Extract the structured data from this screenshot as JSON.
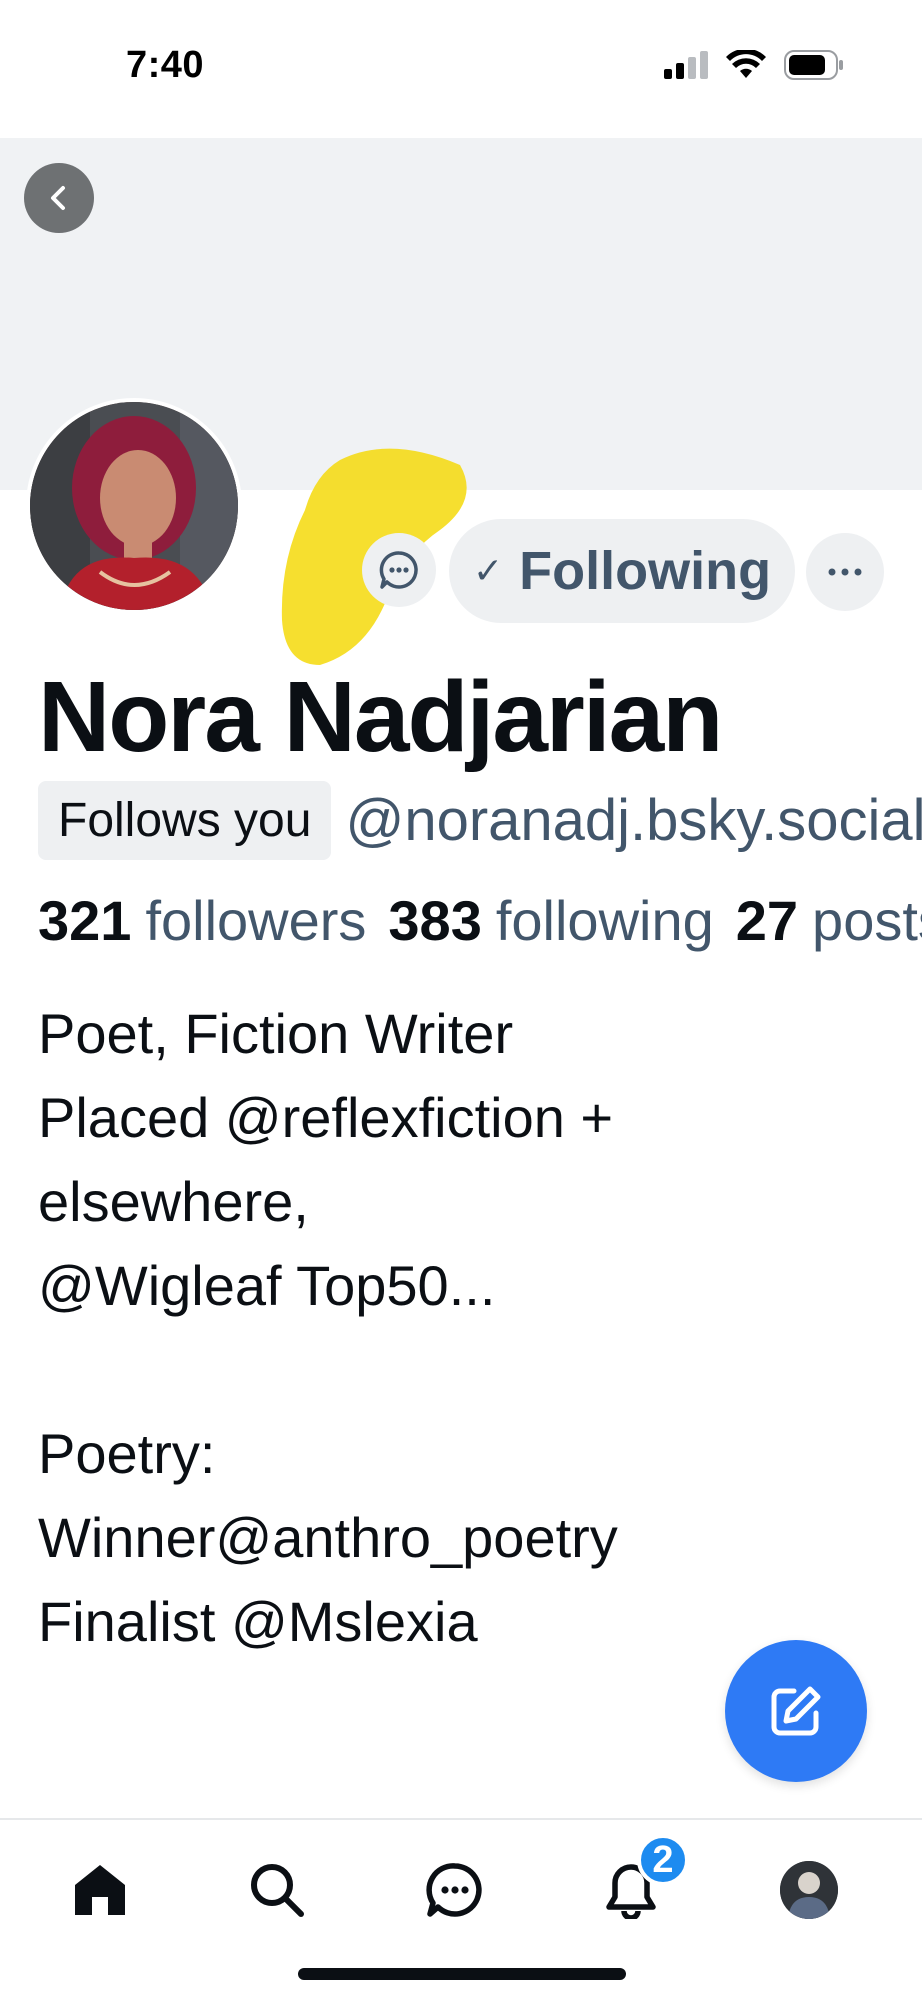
{
  "status_bar": {
    "time": "7:40"
  },
  "profile": {
    "display_name": "Nora Nadjarian",
    "follows_you_label": "Follows you",
    "handle": "@noranadj.bsky.social",
    "following_button_label": "Following",
    "following_check": "✓"
  },
  "stats": {
    "followers_count": "321",
    "followers_label": "followers",
    "following_count": "383",
    "following_label": "following",
    "posts_count": "27",
    "posts_label": "posts"
  },
  "bio": {
    "lines": [
      "Poet, Fiction Writer",
      "Placed @reflexfiction +",
      "elsewhere,",
      "@Wigleaf Top50...",
      "",
      "Poetry:",
      "Winner@anthro_poetry",
      "Finalist @Mslexia"
    ]
  },
  "tab_bar": {
    "tabs": [
      "home-icon",
      "search-icon",
      "chat-icon",
      "bell-icon",
      "profile-avatar"
    ],
    "notifications_badge": "2"
  },
  "colors": {
    "accent": "#2e7af5",
    "secondary_text": "#42566b",
    "banner": "#f0f2f4",
    "badge": "#1d8bf0"
  }
}
